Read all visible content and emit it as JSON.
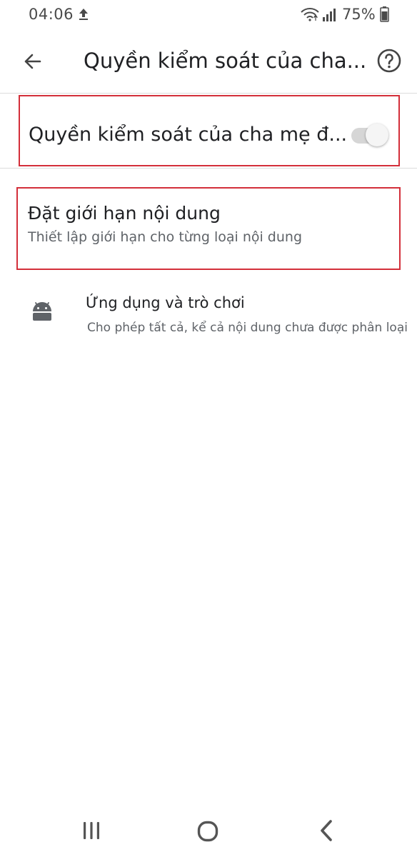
{
  "status_bar": {
    "time": "04:06",
    "battery_percent": "75%",
    "icons": [
      "upload-icon",
      "wifi-icon",
      "signal-icon",
      "battery-icon"
    ]
  },
  "app_bar": {
    "title": "Quyền kiểm soát của cha...",
    "back_icon": "arrow-back-icon",
    "help_icon": "help-icon"
  },
  "parental_controls": {
    "label": "Quyền kiểm soát của cha mẹ đ...",
    "toggle_on": false
  },
  "content_restrictions": {
    "title": "Đặt giới hạn nội dung",
    "subtitle": "Thiết lập giới hạn cho từng loại nội dung"
  },
  "apps_games": {
    "icon": "android-icon",
    "title": "Ứng dụng và trò chơi",
    "subtitle": "Cho phép tất cả, kể cả nội dung chưa được phân loại"
  },
  "nav_bar": {
    "icons": [
      "recents-icon",
      "home-icon",
      "back-icon"
    ]
  },
  "colors": {
    "highlight_border": "#d32f3a",
    "text_primary": "#202124",
    "text_secondary": "#5f6368",
    "switch_track_off": "#d6d6d6"
  }
}
